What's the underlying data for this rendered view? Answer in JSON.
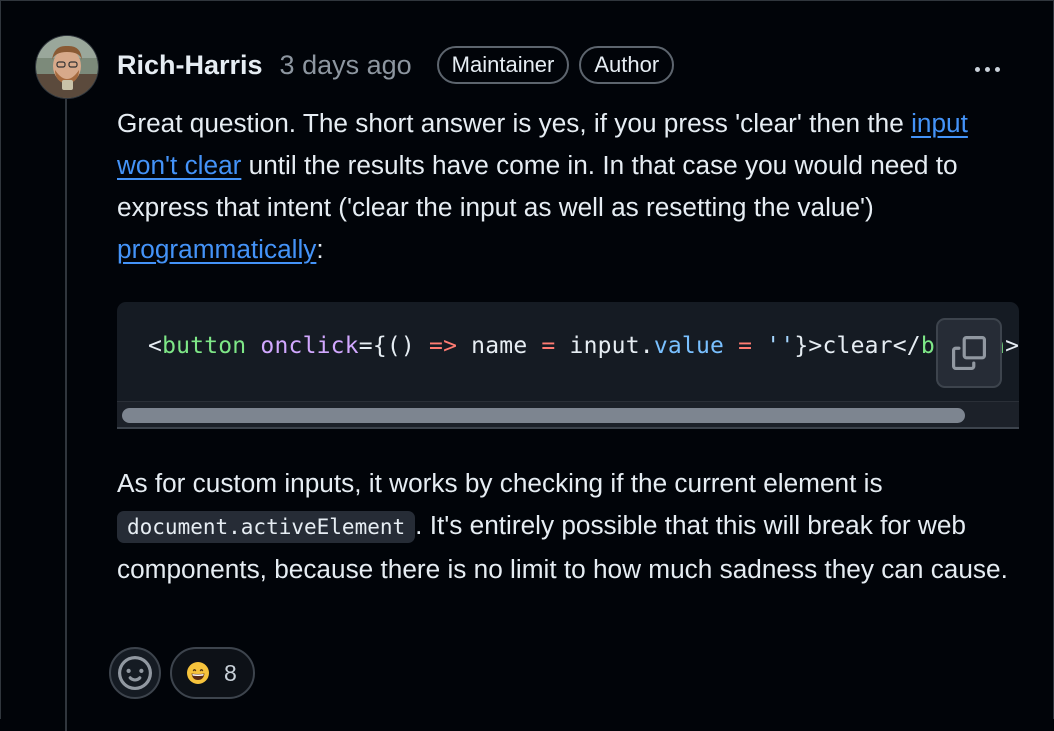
{
  "comment": {
    "author": "Rich-Harris",
    "time": "3 days ago",
    "badges": [
      "Maintainer",
      "Author"
    ],
    "menu_icon": "kebab-horizontal-icon",
    "paragraph1": {
      "part1": "Great question. The short answer is yes, if you press 'clear' then the ",
      "link1": "input won't clear",
      "part2": " until the results have come in. In that case you would need to express that intent ('clear the input as well as resetting the value') ",
      "link2": "programmatically",
      "part3": ":"
    },
    "code": {
      "tokens": [
        {
          "text": "<",
          "cls": ""
        },
        {
          "text": "button",
          "cls": "tok-tag"
        },
        {
          "text": " ",
          "cls": ""
        },
        {
          "text": "onclick",
          "cls": "tok-attr"
        },
        {
          "text": "={() ",
          "cls": ""
        },
        {
          "text": "=>",
          "cls": "tok-op"
        },
        {
          "text": " name ",
          "cls": ""
        },
        {
          "text": "=",
          "cls": "tok-op"
        },
        {
          "text": " input.",
          "cls": ""
        },
        {
          "text": "value",
          "cls": "tok-prop"
        },
        {
          "text": " ",
          "cls": ""
        },
        {
          "text": "=",
          "cls": "tok-op"
        },
        {
          "text": " ",
          "cls": ""
        },
        {
          "text": "''",
          "cls": "tok-str"
        },
        {
          "text": "}>clear</",
          "cls": ""
        },
        {
          "text": "button",
          "cls": "tok-tag"
        },
        {
          "text": ">",
          "cls": ""
        }
      ],
      "copy_icon": "copy-icon"
    },
    "paragraph2": {
      "part1": "As for custom inputs, it works by checking if the current element is ",
      "code": "document.activeElement",
      "part2": ". It's entirely possible that this will break for web components, because there is no limit to how much sadness they can cause."
    },
    "reactions": {
      "add_icon": "smiley-icon",
      "items": [
        {
          "emoji": "grinning-face-icon",
          "count": "8"
        }
      ]
    }
  },
  "colors": {
    "background": "#010409",
    "link": "#4493f8",
    "muted": "#8d96a0",
    "border": "#3d444d"
  }
}
